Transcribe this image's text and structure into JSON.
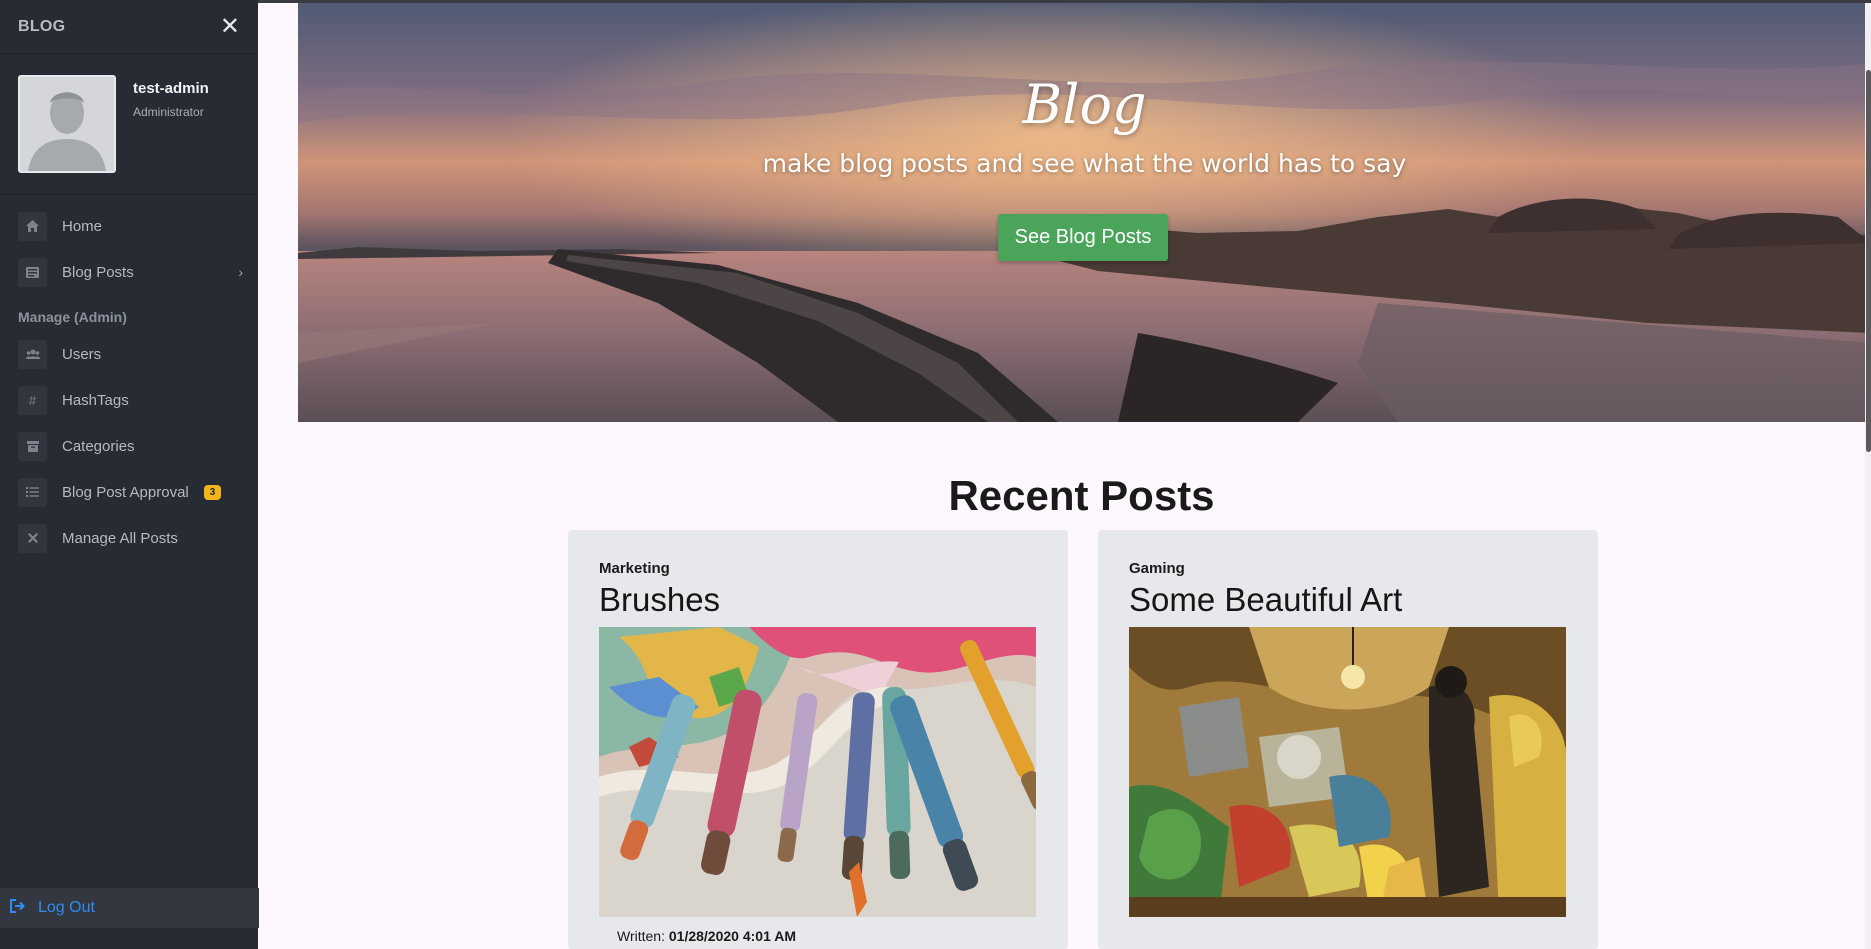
{
  "sidebar": {
    "brand": "BLOG",
    "close_icon": "close-icon",
    "user": {
      "name": "test-admin",
      "role": "Administrator"
    },
    "items": [
      {
        "label": "Home",
        "icon": "home-icon"
      },
      {
        "label": "Blog Posts",
        "icon": "newspaper-icon",
        "caret": "›"
      }
    ],
    "admin_section": "Manage (Admin)",
    "admin_items": [
      {
        "label": "Users",
        "icon": "users-icon"
      },
      {
        "label": "HashTags",
        "icon": "hashtag-icon",
        "glyph": "#"
      },
      {
        "label": "Categories",
        "icon": "archive-icon"
      },
      {
        "label": "Blog Post Approval",
        "icon": "list-icon",
        "badge": "3"
      },
      {
        "label": "Manage All Posts",
        "icon": "tools-icon"
      }
    ],
    "logout": {
      "label": "Log Out",
      "icon": "sign-out-icon"
    }
  },
  "hero": {
    "title": "Blog",
    "subtitle": "make blog posts and see what the world has to say",
    "button": "See Blog Posts"
  },
  "recent": {
    "title": "Recent Posts",
    "posts": [
      {
        "category": "Marketing",
        "title": "Brushes",
        "written_label": "Written:",
        "written_date": "01/28/2020 4:01 AM"
      },
      {
        "category": "Gaming",
        "title": "Some Beautiful Art"
      }
    ]
  },
  "colors": {
    "sidebar_bg": "#272b33",
    "accent_blue": "#2f8cf0",
    "button_green": "#4aa55a",
    "badge_yellow": "#f3b41b",
    "page_bg": "#fcf8fd",
    "card_bg": "#e6e8ec"
  }
}
